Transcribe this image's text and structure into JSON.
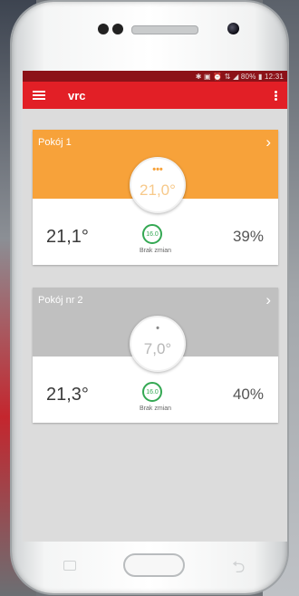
{
  "status_bar": {
    "text": "✱ ▣ ⏰ ⇅ ◢ 80% ▮ 12:31"
  },
  "app_bar": {
    "title": "vrc"
  },
  "rooms": [
    {
      "name": "Pokój 1",
      "set_temp": "21,0°",
      "current_temp": "21,1°",
      "humidity": "39%",
      "status": "Brak zmian",
      "indicator": "•••",
      "mode_icon_text": "16.0"
    },
    {
      "name": "Pokój nr 2",
      "set_temp": "7,0°",
      "current_temp": "21,3°",
      "humidity": "40%",
      "status": "Brak zmian",
      "indicator": "•",
      "mode_icon_text": "16.0"
    }
  ],
  "colors": {
    "accent": "#e21f26",
    "status_bar": "#8c1218",
    "room1_header": "#f7a23a",
    "room2_header": "#c0c0c0",
    "mode_icon": "#34a853"
  },
  "icons": {
    "menu": "hamburger-menu-icon",
    "more": "more-vert-icon",
    "chevron": "chevron-right-icon",
    "mode": "thermostat-mode-icon",
    "recent": "recent-apps-icon",
    "back": "back-icon"
  }
}
